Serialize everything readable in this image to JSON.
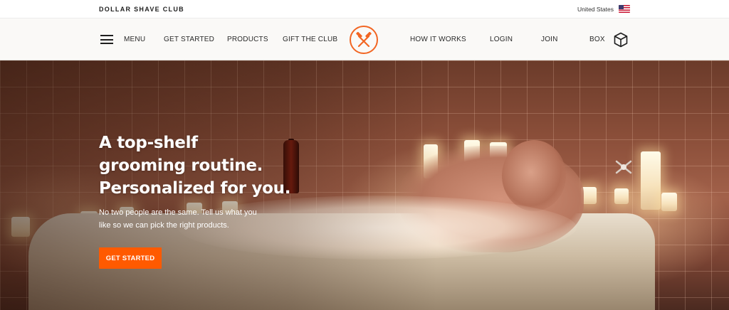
{
  "topbar": {
    "brand": "DOLLAR SHAVE CLUB",
    "region": "United States",
    "region_flag_icon": "us-flag-icon"
  },
  "nav": {
    "menu_label": "MENU",
    "get_started": "GET STARTED",
    "products": "PRODUCTS",
    "gift": "GIFT THE CLUB",
    "how_it_works": "HOW IT WORKS",
    "login": "LOGIN",
    "join": "JOIN",
    "box": "BOX",
    "logo_icon": "crossed-razors-logo-icon",
    "box_icon": "cube-icon"
  },
  "hero": {
    "headline_line1": "A top-shelf",
    "headline_line2": "grooming routine.",
    "headline_line3": "Personalized for you.",
    "subcopy": "No two people are the same. Tell us what you like so we can pick the right products.",
    "cta_label": "GET STARTED"
  },
  "colors": {
    "accent": "#ff5a00",
    "logo_orange": "#f26522",
    "nav_bg": "#faf9f7"
  }
}
